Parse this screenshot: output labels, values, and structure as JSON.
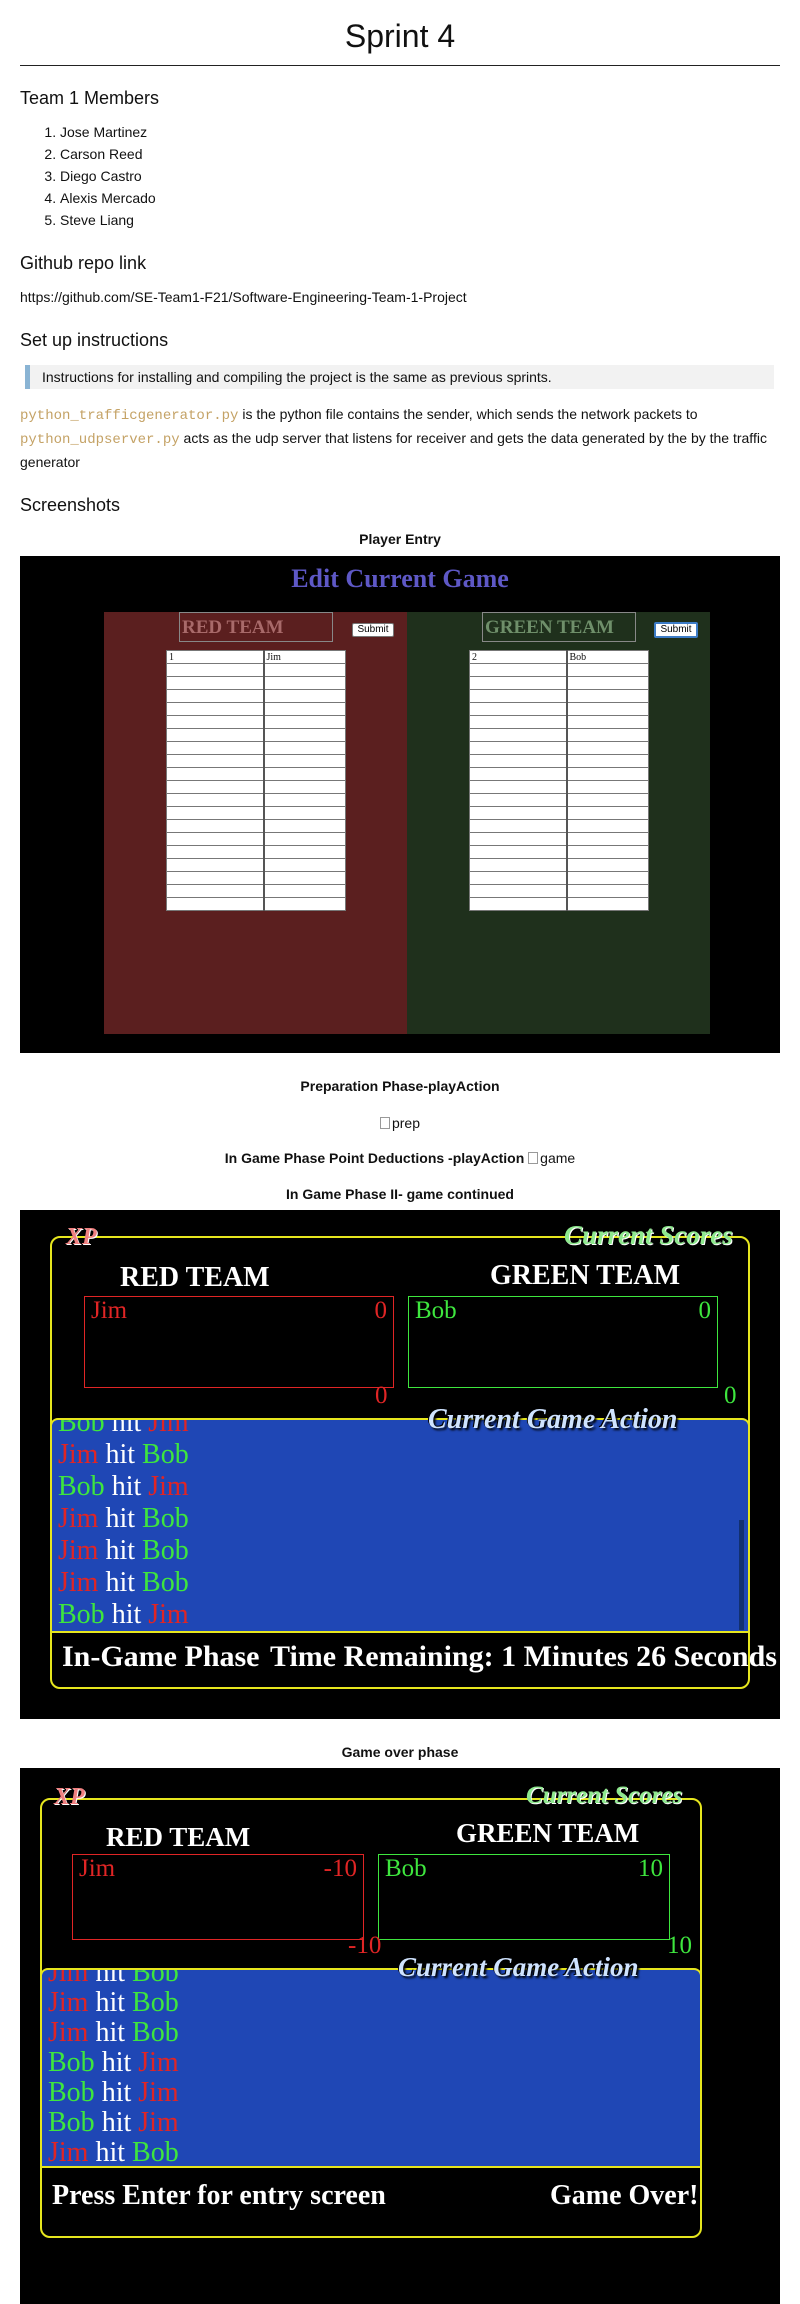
{
  "title": "Sprint 4",
  "team_heading": "Team 1 Members",
  "members": [
    "Jose Martinez",
    "Carson Reed",
    "Diego Castro",
    "Alexis Mercado",
    "Steve Liang"
  ],
  "repo_heading": "Github repo link",
  "repo_url": "https://github.com/SE-Team1-F21/Software-Engineering-Team-1-Project",
  "setup_heading": "Set up instructions",
  "setup_note": "Instructions for installing and compiling the project is the same as previous sprints.",
  "desc": {
    "file1": "python_trafficgenerator.py",
    "text1": " is the python file contains the sender, which sends the network packets to ",
    "file2": "python_udpserver.py",
    "text2": " acts as the udp server that listens for receiver and gets the data generated by the by the traffic generator"
  },
  "screenshots_heading": "Screenshots",
  "captions": {
    "player_entry": "Player Entry",
    "prep": "Preparation Phase-playAction",
    "prep_alt": "prep",
    "deductions": "In Game Phase Point Deductions -playAction",
    "deductions_alt": "game",
    "phase2": "In Game Phase II- game continued",
    "gameover": "Game over phase"
  },
  "entry": {
    "title": "Edit Current Game",
    "submit": "Submit",
    "red": {
      "label": "RED TEAM",
      "row1_id": "1",
      "row1_name": "Jim"
    },
    "green": {
      "label": "GREEN TEAM",
      "row1_id": "2",
      "row1_name": "Bob"
    }
  },
  "game": {
    "xp": "XP",
    "current_scores": "Current Scores",
    "current_action": "Current Game Action",
    "red_team": "RED TEAM",
    "green_team": "GREEN TEAM",
    "hit_word": "hit"
  },
  "game2": {
    "red_player": "Jim",
    "red_score": "0",
    "red_total": "0",
    "green_player": "Bob",
    "green_score": "0",
    "green_total": "0",
    "actions": [
      {
        "a": "Bob",
        "ac": "green",
        "b": "Jim",
        "bc": "red"
      },
      {
        "a": "Jim",
        "ac": "red",
        "b": "Bob",
        "bc": "green"
      },
      {
        "a": "Bob",
        "ac": "green",
        "b": "Jim",
        "bc": "red"
      },
      {
        "a": "Jim",
        "ac": "red",
        "b": "Bob",
        "bc": "green"
      },
      {
        "a": "Jim",
        "ac": "red",
        "b": "Bob",
        "bc": "green"
      },
      {
        "a": "Jim",
        "ac": "red",
        "b": "Bob",
        "bc": "green"
      },
      {
        "a": "Bob",
        "ac": "green",
        "b": "Jim",
        "bc": "red"
      }
    ],
    "phase_label": "In-Game Phase",
    "time_remaining": "Time Remaining: 1 Minutes 26 Seconds"
  },
  "game3": {
    "red_player": "Jim",
    "red_score": "-10",
    "red_total": "-10",
    "green_player": "Bob",
    "green_score": "10",
    "green_total": "10",
    "actions": [
      {
        "a": "Jim",
        "ac": "red",
        "b": "Bob",
        "bc": "green"
      },
      {
        "a": "Jim",
        "ac": "red",
        "b": "Bob",
        "bc": "green"
      },
      {
        "a": "Jim",
        "ac": "red",
        "b": "Bob",
        "bc": "green"
      },
      {
        "a": "Bob",
        "ac": "green",
        "b": "Jim",
        "bc": "red"
      },
      {
        "a": "Bob",
        "ac": "green",
        "b": "Jim",
        "bc": "red"
      },
      {
        "a": "Bob",
        "ac": "green",
        "b": "Jim",
        "bc": "red"
      },
      {
        "a": "Jim",
        "ac": "red",
        "b": "Bob",
        "bc": "green"
      }
    ],
    "press_enter": "Press Enter for entry screen",
    "game_over": "Game Over!"
  }
}
